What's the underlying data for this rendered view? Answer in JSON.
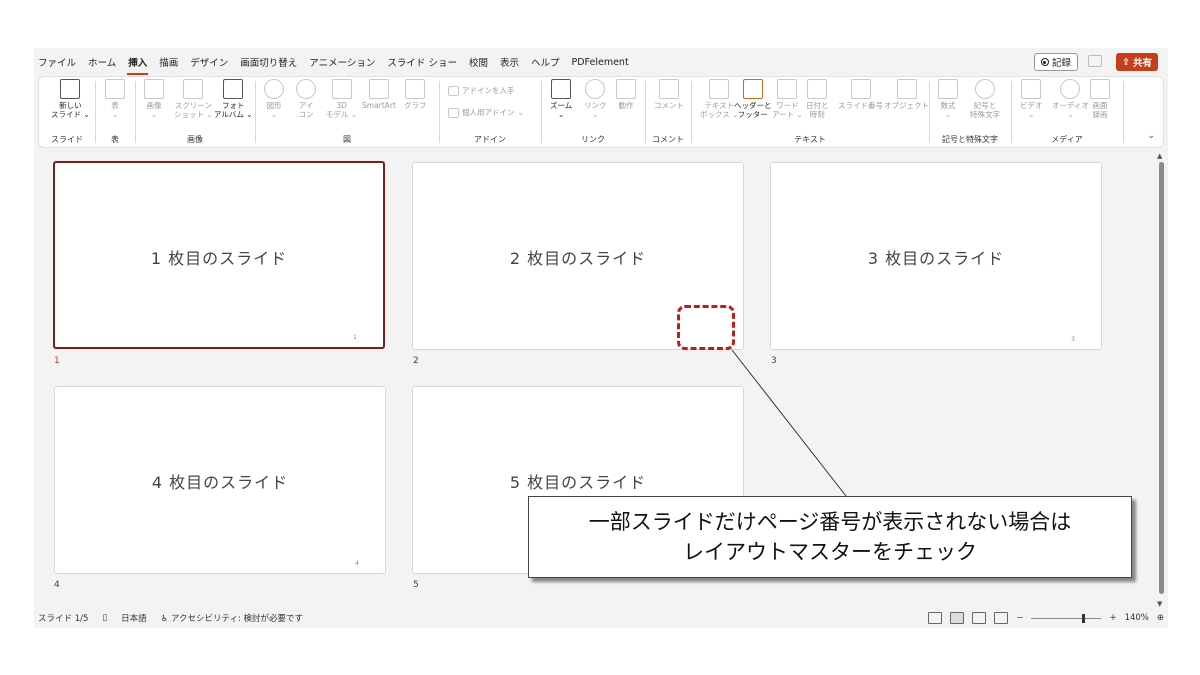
{
  "menu": [
    "ファイル",
    "ホーム",
    "挿入",
    "描画",
    "デザイン",
    "画面切り替え",
    "アニメーション",
    "スライド ショー",
    "校閲",
    "表示",
    "ヘルプ",
    "PDFelement"
  ],
  "active_menu_index": 2,
  "record_label": "記録",
  "share_label": "共有",
  "ribbon": {
    "new_slide": "新しい\nスライド ⌄",
    "table": "表\n⌄",
    "image": "画像\n⌄",
    "screenshot": "スクリーン\nショット ⌄",
    "photo_album": "フォト\nアルバム ⌄",
    "shapes": "図形\n⌄",
    "icons": "アイ\nコン",
    "model3d": "3D\nモデル ⌄",
    "smartart": "SmartArt",
    "graph": "グラフ",
    "get_addins": "アドインを入手",
    "my_addins": "個人用アドイン",
    "zoom": "ズーム\n⌄",
    "link": "リンク\n⌄",
    "action": "動作",
    "comment": "コメント",
    "textbox": "テキスト\nボックス ⌄",
    "header_footer": "ヘッダーと\nフッター",
    "wordart": "ワード\nアート ⌄",
    "datetime": "日付と\n時刻",
    "slide_number": "スライド番号",
    "object": "オブジェクト",
    "equation": "数式\n⌄",
    "symbol": "記号と\n特殊文字",
    "video": "ビデオ\n⌄",
    "audio": "オーディオ\n⌄",
    "screen_record": "画面\n録画",
    "groups": [
      "スライド",
      "表",
      "画像",
      "図",
      "アドイン",
      "リンク",
      "コメント",
      "テキスト",
      "記号と特殊文字",
      "メディア"
    ]
  },
  "slides": [
    {
      "title": "1 枚目のスライド",
      "page_number": "1",
      "index": "1"
    },
    {
      "title": "2 枚目のスライド",
      "page_number": "",
      "index": "2"
    },
    {
      "title": "3 枚目のスライド",
      "page_number": "3",
      "index": "3"
    },
    {
      "title": "4 枚目のスライド",
      "page_number": "4",
      "index": "4"
    },
    {
      "title": "5 枚目のスライド",
      "page_number": "",
      "index": "5"
    }
  ],
  "status": {
    "slide_info": "スライド 1/5",
    "language": "日本語",
    "accessibility": "アクセシビリティ: 検討が必要です",
    "zoom": "140%",
    "zoom_minus": "−",
    "zoom_plus": "+"
  },
  "callout": {
    "line1": "一部スライドだけページ番号が表示されない場合は",
    "line2": "レイアウトマスターをチェック"
  },
  "colors": {
    "accent": "#c43e1c",
    "selected_border": "#7a1f1f",
    "annotation_red": "#c21b1b"
  }
}
